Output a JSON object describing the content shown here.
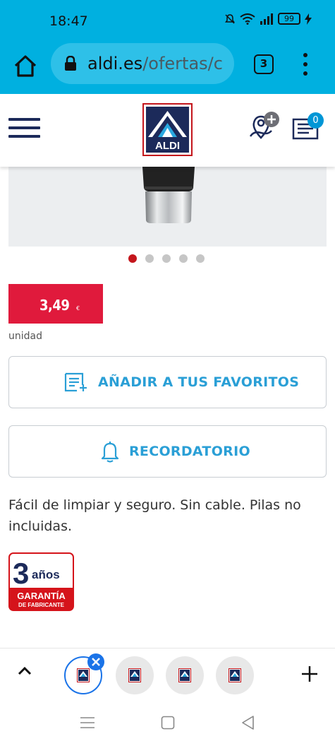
{
  "status_bar": {
    "time": "18:47",
    "battery": "99"
  },
  "browser": {
    "url_domain": "aldi.es",
    "url_path": "/ofertas/c",
    "tab_count": "3"
  },
  "site_header": {
    "logo_text": "ALDI",
    "list_count": "0"
  },
  "product": {
    "carousel_dots": 5,
    "active_dot": 0,
    "price": "3,49",
    "currency": "€",
    "unit": "unidad",
    "favorites_label": "AÑADIR A TUS FAVORITOS",
    "reminder_label": "RECORDATORIO",
    "description": "Fácil de limpiar y seguro. Sin cable. Pilas no incluidas.",
    "warranty": {
      "years": "3",
      "years_unit": "años",
      "line1": "GARANTÍA",
      "line2": "DE FABRICANTE"
    }
  },
  "colors": {
    "browser_bar": "#00b0e0",
    "price_bg": "#e01a3c",
    "accent_blue": "#2a9fd6",
    "aldi_navy": "#1c2a5a",
    "aldi_red": "#c4161c"
  },
  "icons": [
    "home-icon",
    "lock-icon",
    "tabs-icon",
    "overflow-menu-icon",
    "hamburger-icon",
    "store-locator-icon",
    "shopping-list-icon",
    "add-to-list-icon",
    "bell-icon",
    "chevron-up-icon",
    "close-icon",
    "plus-icon",
    "nav-menu-icon",
    "nav-home-icon",
    "nav-back-icon"
  ]
}
